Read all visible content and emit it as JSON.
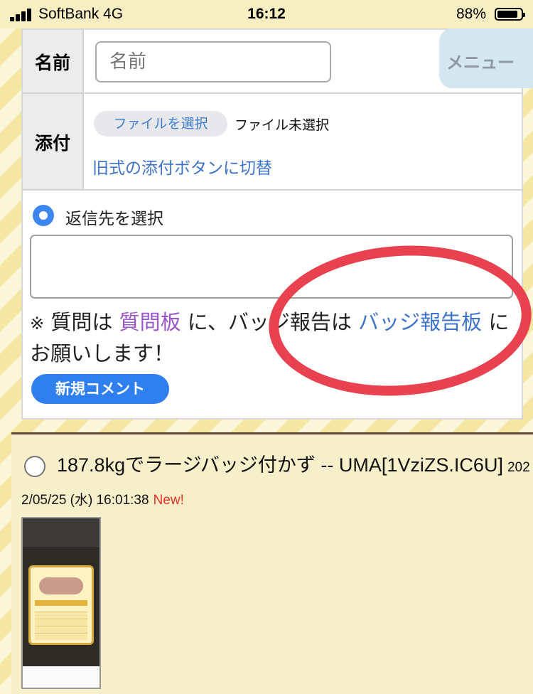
{
  "status_bar": {
    "carrier": "SoftBank  4G",
    "time": "16:12",
    "battery_percent": "88%",
    "battery_level": 0.88
  },
  "form": {
    "name_label": "名前",
    "name_placeholder": "名前",
    "attach_label": "添付",
    "file_button": "ファイルを選択",
    "file_status": "ファイル未選択",
    "legacy_link": "旧式の添付ボタンに切替",
    "reply_label": "返信先を選択",
    "reply_value": "",
    "notice_mark": "※",
    "notice_part1": "質問は",
    "notice_link1": "質問板",
    "notice_part2": "に、バッジ報告は",
    "notice_link2": "バッジ報告板",
    "notice_part3": "にお願いします！",
    "new_comment_button": "新規コメント"
  },
  "menu": {
    "label": "メニュー"
  },
  "post": {
    "title": "187.8kgでラージバッジ付かず -- UMA[1VziZS.IC6U]",
    "date": "2022/05/25 (水) 16:01:38",
    "new_badge": "New!"
  },
  "colors": {
    "accent": "#2f80ee",
    "link": "#3c73c9",
    "visited_link": "#9a55c8",
    "annotation": "#e8414f",
    "new_badge": "#e0322a"
  }
}
